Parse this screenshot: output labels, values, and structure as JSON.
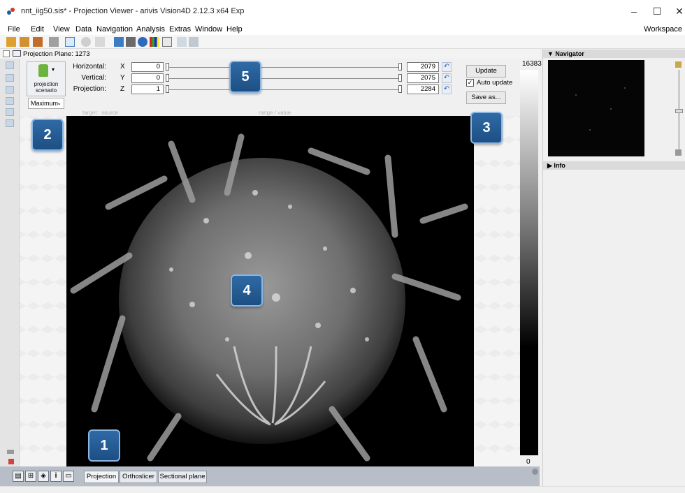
{
  "window": {
    "title": "nnt_iig50.sis* - Projection Viewer - arivis Vision4D 2.12.3 x64 Exp",
    "minimize": "–",
    "maximize": "☐",
    "close": "✕"
  },
  "menu": [
    "File",
    "Edit",
    "View",
    "Data",
    "Navigation",
    "Analysis",
    "Extras",
    "Window",
    "Help"
  ],
  "workspace_label": "Workspace",
  "viewer_header": {
    "label": "Projection  Plane: 1273"
  },
  "controls": {
    "projection_button": "projection scenario",
    "projection_mode": "Maximum",
    "axes": [
      {
        "label": "Horizontal:",
        "letter": "X",
        "min": "0",
        "max": "2079"
      },
      {
        "label": "Vertical:",
        "letter": "Y",
        "min": "0",
        "max": "2075"
      },
      {
        "label": "Projection:",
        "letter": "Z",
        "min": "1",
        "max": "2284"
      }
    ],
    "hint_left": "target : source",
    "hint_right": "range / value",
    "update_button": "Update",
    "auto_update_label": "Auto update",
    "auto_update_checked": true,
    "save_as_button": "Save as..."
  },
  "scale": {
    "max": "16383",
    "min": "0"
  },
  "bottom_tabs": [
    "Projection",
    "Orthoslicer",
    "Sectional plane"
  ],
  "bottom_icons": [
    "list-view-icon",
    "grid-view-icon",
    "cube-icon",
    "info-icon",
    "monitor-icon"
  ],
  "info_glyph": "i",
  "right_panel": {
    "navigator_title": "Navigator",
    "info_title": "Info"
  },
  "callouts": [
    "1",
    "2",
    "3",
    "4",
    "5"
  ],
  "colors": {
    "badge": "#1d4f83",
    "bottom_bar": "#b8bec8",
    "image_bg": "#000000"
  }
}
